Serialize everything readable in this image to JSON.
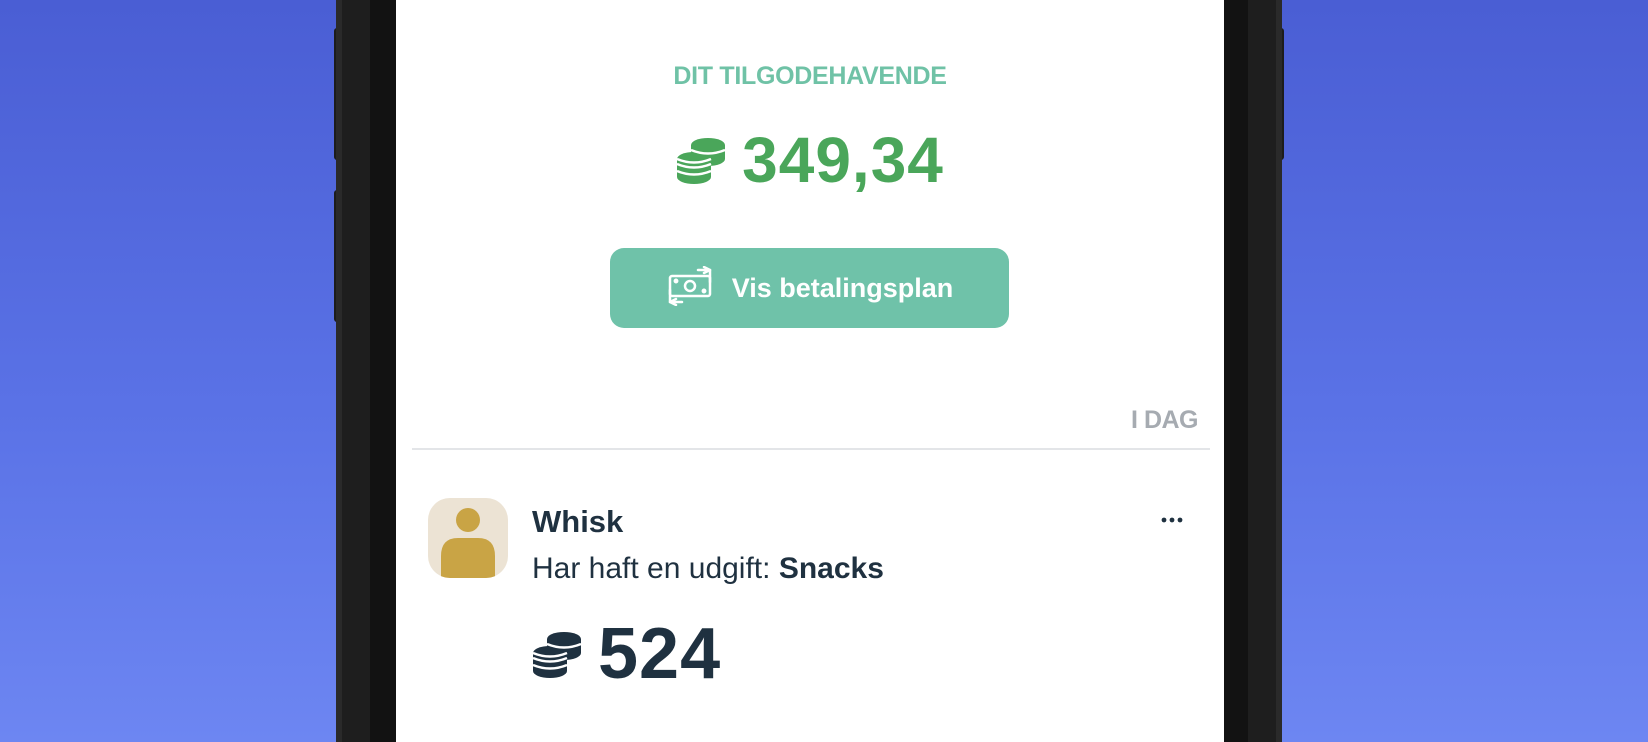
{
  "balance": {
    "label": "DIT TILGODEHAVENDE",
    "value": "349,34",
    "color": "#4aa65a",
    "icon": "coins-icon"
  },
  "plan_button": {
    "label": "Vis betalingsplan",
    "icon": "money-exchange-icon",
    "color": "#6fc2a9"
  },
  "feed": {
    "section_header": "I DAG",
    "items": [
      {
        "name": "Whisk",
        "description_prefix": "Har haft en udgift: ",
        "description_highlight": "Snacks",
        "amount": "524",
        "avatar_icon": "user-avatar-icon",
        "more_label": "···",
        "amount_icon": "coins-icon"
      }
    ]
  }
}
